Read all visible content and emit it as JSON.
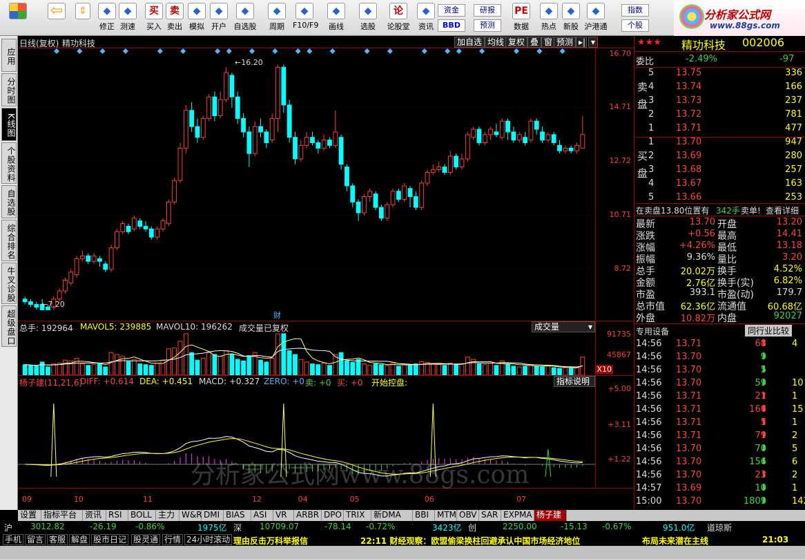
{
  "toolbar": {
    "buttons": [
      {
        "label": "修正",
        "icon": "clock-icon"
      },
      {
        "label": "测速",
        "icon": "stopwatch-icon"
      },
      {
        "label": "买入",
        "icon": "buy-icon",
        "glyph": "买"
      },
      {
        "label": "卖出",
        "icon": "sell-icon",
        "glyph": "卖"
      },
      {
        "label": "模拟",
        "icon": "hammer-icon"
      },
      {
        "label": "开户",
        "icon": "lock-icon"
      },
      {
        "label": "自选股",
        "icon": "star-icon"
      },
      {
        "label": "周期",
        "icon": "cycle-icon"
      },
      {
        "label": "F10/F9",
        "icon": "f10-icon"
      },
      {
        "label": "画线",
        "icon": "pen-icon"
      },
      {
        "label": "选股",
        "icon": "filter-icon"
      },
      {
        "label": "论股堂",
        "icon": "forum-icon",
        "glyph": "论"
      },
      {
        "label": "资讯",
        "icon": "info-icon"
      },
      {
        "label": "数据",
        "icon": "pe-icon",
        "glyph": "PE"
      },
      {
        "label": "热点",
        "icon": "flame-icon"
      },
      {
        "label": "新股",
        "icon": "new-stock-icon"
      },
      {
        "label": "沪港通",
        "icon": "hk-link-icon"
      }
    ],
    "small_buttons": [
      "资金",
      "BBD",
      "研报",
      "预测",
      "指数",
      "个股"
    ]
  },
  "logo": {
    "line1": "分析家公式网",
    "line2": "www.88gs.com"
  },
  "side_tabs": [
    "应用",
    "分时图",
    "K线图",
    "个股资料",
    "自选股",
    "综合排名",
    "牛叉诊股",
    "超级盘口"
  ],
  "chart_header": {
    "title": "日线(复权)",
    "stock": "精功科技",
    "buttons": [
      "加自选",
      "均线",
      "复权",
      "叠",
      "窗",
      "预测"
    ]
  },
  "price_axis": [
    "16.70",
    "14.71",
    "12.72",
    "10.71",
    "8.72"
  ],
  "high_label": "16.20",
  "low_label": "7.20",
  "cai_label": "财",
  "volume_header": {
    "total": "总手: 192964",
    "mavol5": "MAVOL5: 239885",
    "mavol10": "MAVOL10: 196262",
    "note": "成交量已复权",
    "menu": "成交量"
  },
  "volume_axis": [
    "91735",
    "45867",
    "X10"
  ],
  "indicator_header": {
    "name": "杨子建(11,21,6)",
    "diff": "DIFF: +0.614",
    "dea": "DEA: +0.451",
    "macd": "MACD: +0.327",
    "zero": "ZERO: +0",
    "sell": "卖: +0",
    "buy": "买: +0",
    "start": "开始控盘:",
    "explain": "指标说明"
  },
  "indicator_axis": [
    "+5.00",
    "+3.11",
    "+1.22"
  ],
  "watermark": "分析家公式网www.88gs.com",
  "date_axis": [
    "09",
    "10",
    "11",
    "12",
    "04",
    "05",
    "06",
    "07"
  ],
  "quote": {
    "stars": "★★★",
    "name": "精功科技",
    "code": "002006",
    "weibi_label": "委比",
    "weibi": "-2.49%",
    "weicha": "-97",
    "sell_label": "卖盘",
    "buy_label": "买盘",
    "asks": [
      {
        "lvl": "5",
        "price": "13.75",
        "vol": "336"
      },
      {
        "lvl": "4",
        "price": "13.74",
        "vol": "166"
      },
      {
        "lvl": "3",
        "price": "13.73",
        "vol": "237"
      },
      {
        "lvl": "2",
        "price": "13.72",
        "vol": "781"
      },
      {
        "lvl": "1",
        "price": "13.71",
        "vol": "477"
      }
    ],
    "bids": [
      {
        "lvl": "1",
        "price": "13.70",
        "vol": "947"
      },
      {
        "lvl": "2",
        "price": "13.69",
        "vol": "280"
      },
      {
        "lvl": "3",
        "price": "13.68",
        "vol": "257"
      },
      {
        "lvl": "4",
        "price": "13.67",
        "vol": "163"
      },
      {
        "lvl": "5",
        "price": "13.66",
        "vol": "253"
      }
    ],
    "mid_line": {
      "text": "在卖盘13.80位置有",
      "vol": "342手",
      "suffix": "卖单!",
      "detail": "查看详细"
    },
    "stats": [
      {
        "l1": "最新",
        "v1": "13.70",
        "c1": "red",
        "l2": "开盘",
        "v2": "13.20",
        "c2": "red"
      },
      {
        "l1": "涨跌",
        "v1": "+0.56",
        "c1": "red",
        "l2": "最高",
        "v2": "14.41",
        "c2": "red"
      },
      {
        "l1": "涨幅",
        "v1": "+4.26%",
        "c1": "red",
        "l2": "最低",
        "v2": "13.18",
        "c2": "red"
      },
      {
        "l1": "振幅",
        "v1": "9.36%",
        "c1": "w",
        "l2": "量比",
        "v2": "3.20",
        "c2": "red"
      },
      {
        "l1": "总手",
        "v1": "20.02万",
        "c1": "yel",
        "l2": "换手",
        "v2": "4.52%",
        "c2": "yel"
      },
      {
        "l1": "金额",
        "v1": "2.76亿",
        "c1": "yel",
        "l2": "换手(实)",
        "v2": "6.82%",
        "c2": "yel"
      },
      {
        "l1": "市盈",
        "v1": "393.1",
        "c1": "w",
        "l2": "市盈(动)",
        "v2": "179.7",
        "c2": "w"
      },
      {
        "l1": "总市值",
        "v1": "62.36亿",
        "c1": "yel",
        "l2": "流通值",
        "v2": "60.68亿",
        "c2": "yel"
      },
      {
        "l1": "外盘",
        "v1": "10.82万",
        "c1": "red",
        "l2": "内盘",
        "v2": "92027",
        "c2": "grn"
      }
    ],
    "device_label": "专用设备",
    "compare": "同行业比较",
    "ticks": [
      {
        "t": "14:56",
        "p": "13.71",
        "v": "68",
        "d": "up",
        "x": "4"
      },
      {
        "t": "14:56",
        "p": "13.70",
        "v": "9",
        "d": "down",
        "x": ""
      },
      {
        "t": "14:56",
        "p": "13.70",
        "v": "5",
        "d": "down",
        "x": ""
      },
      {
        "t": "14:56",
        "p": "13.70",
        "v": "59",
        "d": "down",
        "x": "10"
      },
      {
        "t": "14:56",
        "p": "13.71",
        "v": "21",
        "d": "up",
        "x": "1"
      },
      {
        "t": "14:56",
        "p": "13.71",
        "v": "166",
        "d": "up",
        "x": "15"
      },
      {
        "t": "14:56",
        "p": "13.71",
        "v": "5",
        "d": "up",
        "x": "1"
      },
      {
        "t": "14:56",
        "p": "13.71",
        "v": "79",
        "d": "up",
        "x": "2"
      },
      {
        "t": "14:56",
        "p": "13.70",
        "v": "70",
        "d": "down",
        "x": "5"
      },
      {
        "t": "14:56",
        "p": "13.70",
        "v": "156",
        "d": "down",
        "x": "6"
      },
      {
        "t": "14:56",
        "p": "13.70",
        "v": "23",
        "d": "up",
        "x": "2"
      },
      {
        "t": "14:57",
        "p": "13.69",
        "v": "10",
        "d": "down",
        "x": "1"
      },
      {
        "t": "15:00",
        "p": "13.70",
        "v": "1809",
        "d": "down",
        "x": "142"
      }
    ],
    "bottom_tabs": [
      "细",
      "诊",
      "分",
      "筹",
      "焰",
      "指",
      "财"
    ]
  },
  "indicator_tabs": [
    "设置",
    "指标平台",
    "资讯",
    "RSI",
    "BOLL",
    "主力",
    "W&R",
    "DMI",
    "BIAS",
    "ASI",
    "VR",
    "ARBR",
    "DPO",
    "TRIX",
    "新DMA",
    "BBI",
    "MTM",
    "OBV",
    "SAR",
    "EXPMA",
    "杨子建"
  ],
  "status": {
    "sh_label": "沪",
    "sh_index": "3012.82",
    "sh_chg": "-26.19",
    "sh_pct": "-0.86%",
    "sh_amt": "1975亿",
    "sz_label": "深",
    "sz_index": "10709.07",
    "sz_chg": "-78.14",
    "sz_pct": "-0.72%",
    "sz_amt": "3423亿",
    "cy_label": "创",
    "cy_index": "2250.00",
    "cy_chg": "-15.13",
    "cy_pct": "-0.67%",
    "cy_amt": "951.0亿",
    "extra": "道琼斯"
  },
  "news": {
    "buttons": [
      "手机",
      "留言",
      "客服",
      "解盘",
      "股市日记",
      "股灵通",
      "行情",
      "24小时滚动"
    ],
    "ticker1": "理由反击万科举报信",
    "ticker2": "22:11 财经观察：欧盟偷梁换柱回避承认中国市场经济地位",
    "ticker3": "布局未来潜在主线",
    "time": "21:03"
  },
  "chart_data": {
    "type": "candlestick",
    "title": "",
    "ylim": [
      6.8,
      16.9
    ],
    "candles": [
      [
        7.6,
        7.5,
        7.7,
        7.4
      ],
      [
        7.5,
        7.4,
        7.6,
        7.3
      ],
      [
        7.4,
        7.3,
        7.5,
        7.2
      ],
      [
        7.4,
        7.2,
        7.6,
        7.2
      ],
      [
        7.3,
        7.2,
        7.4,
        7.2
      ],
      [
        7.3,
        7.6,
        7.7,
        7.2
      ],
      [
        7.6,
        7.9,
        8.0,
        7.5
      ],
      [
        7.9,
        8.3,
        8.4,
        7.8
      ],
      [
        8.2,
        8.6,
        8.7,
        8.1
      ],
      [
        8.5,
        9.1,
        9.2,
        8.4
      ],
      [
        9.1,
        9.2,
        9.4,
        9.0
      ],
      [
        9.2,
        9.0,
        9.3,
        8.9
      ],
      [
        9.0,
        9.2,
        9.3,
        8.9
      ],
      [
        9.1,
        9.0,
        9.2,
        8.8
      ],
      [
        8.9,
        8.7,
        9.0,
        8.6
      ],
      [
        8.7,
        9.5,
        9.6,
        8.6
      ],
      [
        9.5,
        10.1,
        10.2,
        9.4
      ],
      [
        10.1,
        10.4,
        10.5,
        10.0
      ],
      [
        10.3,
        10.1,
        10.4,
        10.0
      ],
      [
        10.2,
        10.6,
        10.7,
        10.1
      ],
      [
        10.5,
        10.3,
        10.6,
        10.2
      ],
      [
        10.3,
        10.2,
        10.5,
        10.1
      ],
      [
        10.2,
        9.9,
        10.3,
        9.8
      ],
      [
        9.9,
        10.2,
        10.3,
        9.8
      ],
      [
        10.2,
        10.5,
        10.6,
        10.1
      ],
      [
        10.4,
        11.2,
        11.3,
        10.3
      ],
      [
        11.2,
        12.0,
        12.1,
        11.1
      ],
      [
        12.0,
        13.2,
        13.4,
        11.9
      ],
      [
        13.2,
        14.6,
        14.8,
        13.0
      ],
      [
        14.6,
        14.0,
        14.9,
        13.8
      ],
      [
        14.0,
        13.6,
        14.3,
        13.4
      ],
      [
        13.6,
        14.3,
        14.4,
        13.5
      ],
      [
        14.3,
        15.1,
        15.2,
        14.2
      ],
      [
        15.1,
        14.4,
        15.3,
        14.2
      ],
      [
        14.4,
        15.0,
        15.3,
        14.3
      ],
      [
        15.0,
        16.0,
        16.2,
        14.9
      ],
      [
        15.9,
        15.1,
        16.0,
        14.7
      ],
      [
        15.1,
        14.3,
        15.3,
        14.1
      ],
      [
        14.3,
        13.8,
        14.5,
        13.6
      ],
      [
        13.8,
        13.0,
        14.0,
        12.5
      ],
      [
        13.0,
        14.0,
        14.2,
        12.9
      ],
      [
        14.0,
        13.8,
        14.3,
        13.6
      ],
      [
        13.8,
        13.4,
        13.9,
        13.2
      ],
      [
        13.5,
        14.3,
        14.5,
        13.4
      ],
      [
        14.3,
        16.2,
        16.3,
        13.8
      ],
      [
        16.2,
        14.8,
        16.3,
        14.5
      ],
      [
        14.8,
        13.6,
        15.0,
        13.4
      ],
      [
        13.6,
        12.8,
        13.8,
        12.6
      ],
      [
        12.8,
        13.3,
        13.5,
        12.7
      ],
      [
        13.3,
        13.6,
        13.8,
        13.2
      ],
      [
        13.6,
        13.4,
        13.8,
        13.3
      ],
      [
        13.4,
        13.2,
        13.5,
        13.0
      ],
      [
        13.2,
        13.5,
        13.7,
        13.1
      ],
      [
        13.5,
        13.3,
        13.6,
        13.2
      ],
      [
        13.3,
        13.8,
        14.6,
        13.2
      ],
      [
        13.6,
        12.6,
        13.7,
        12.4
      ],
      [
        12.5,
        11.8,
        12.6,
        11.6
      ],
      [
        11.8,
        11.2,
        11.9,
        11.0
      ],
      [
        11.2,
        10.8,
        11.3,
        10.5
      ],
      [
        10.8,
        11.4,
        11.5,
        10.7
      ],
      [
        11.4,
        11.6,
        11.7,
        11.2
      ],
      [
        11.5,
        11.0,
        11.6,
        10.9
      ],
      [
        11.0,
        10.6,
        11.1,
        10.5
      ],
      [
        10.6,
        11.1,
        11.2,
        10.5
      ],
      [
        11.1,
        11.6,
        11.7,
        11.0
      ],
      [
        11.6,
        11.3,
        11.7,
        11.2
      ],
      [
        11.3,
        11.8,
        11.9,
        11.2
      ],
      [
        11.7,
        11.4,
        11.8,
        11.0
      ],
      [
        11.4,
        11.0,
        11.6,
        10.9
      ],
      [
        11.0,
        11.9,
        12.0,
        10.9
      ],
      [
        11.9,
        12.3,
        12.4,
        11.8
      ],
      [
        12.3,
        12.4,
        12.6,
        12.2
      ],
      [
        12.4,
        12.5,
        12.7,
        12.3
      ],
      [
        12.5,
        12.3,
        12.6,
        12.2
      ],
      [
        12.3,
        12.9,
        13.1,
        12.2
      ],
      [
        12.9,
        12.5,
        13.0,
        12.4
      ],
      [
        12.5,
        12.8,
        13.0,
        12.4
      ],
      [
        12.8,
        13.7,
        13.8,
        12.7
      ],
      [
        13.6,
        13.9,
        14.0,
        13.5
      ],
      [
        13.9,
        13.4,
        14.0,
        13.3
      ],
      [
        13.4,
        13.7,
        13.8,
        13.3
      ],
      [
        13.7,
        13.9,
        14.0,
        13.5
      ],
      [
        13.8,
        13.7,
        14.1,
        13.6
      ],
      [
        13.6,
        14.2,
        14.3,
        13.5
      ],
      [
        14.2,
        13.8,
        14.3,
        13.5
      ],
      [
        13.8,
        13.5,
        14.0,
        13.4
      ],
      [
        13.5,
        13.7,
        13.8,
        13.4
      ],
      [
        13.6,
        13.4,
        13.8,
        13.3
      ],
      [
        13.5,
        14.2,
        14.3,
        13.4
      ],
      [
        14.2,
        13.9,
        14.3,
        13.7
      ],
      [
        13.8,
        13.5,
        14.0,
        13.4
      ],
      [
        13.5,
        13.7,
        13.8,
        13.4
      ],
      [
        13.7,
        13.4,
        13.8,
        13.3
      ],
      [
        13.3,
        13.1,
        13.5,
        13.0
      ],
      [
        13.1,
        13.2,
        13.3,
        13.0
      ],
      [
        13.2,
        13.1,
        13.3,
        13.0
      ],
      [
        13.1,
        13.3,
        13.4,
        13.0
      ],
      [
        13.2,
        13.7,
        14.4,
        13.2
      ]
    ],
    "volume_ylim": [
      0,
      110000
    ],
    "volume_values": [
      28000,
      26000,
      24000,
      35000,
      22000,
      30000,
      32000,
      40000,
      38000,
      45000,
      30000,
      26000,
      28000,
      32000,
      22000,
      60000,
      55000,
      50000,
      36000,
      42000,
      30000,
      28000,
      26000,
      32000,
      40000,
      70000,
      72000,
      90000,
      110000,
      60000,
      40000,
      45000,
      60000,
      55000,
      50000,
      65000,
      55000,
      42000,
      38000,
      52000,
      60000,
      40000,
      35000,
      45000,
      200000,
      120000,
      65000,
      55000,
      42000,
      35000,
      30000,
      28000,
      32000,
      26000,
      55000,
      60000,
      38000,
      34000,
      42000,
      30000,
      26000,
      30000,
      28000,
      26000,
      32000,
      24000,
      28000,
      26000,
      30000,
      36000,
      34000,
      30000,
      28000,
      26000,
      32000,
      28000,
      30000,
      48000,
      42000,
      30000,
      28000,
      32000,
      26000,
      38000,
      30000,
      24000,
      22000,
      24000,
      28000,
      24000,
      22000,
      26000,
      20000,
      18000,
      20000,
      19000,
      20000,
      48000
    ]
  }
}
